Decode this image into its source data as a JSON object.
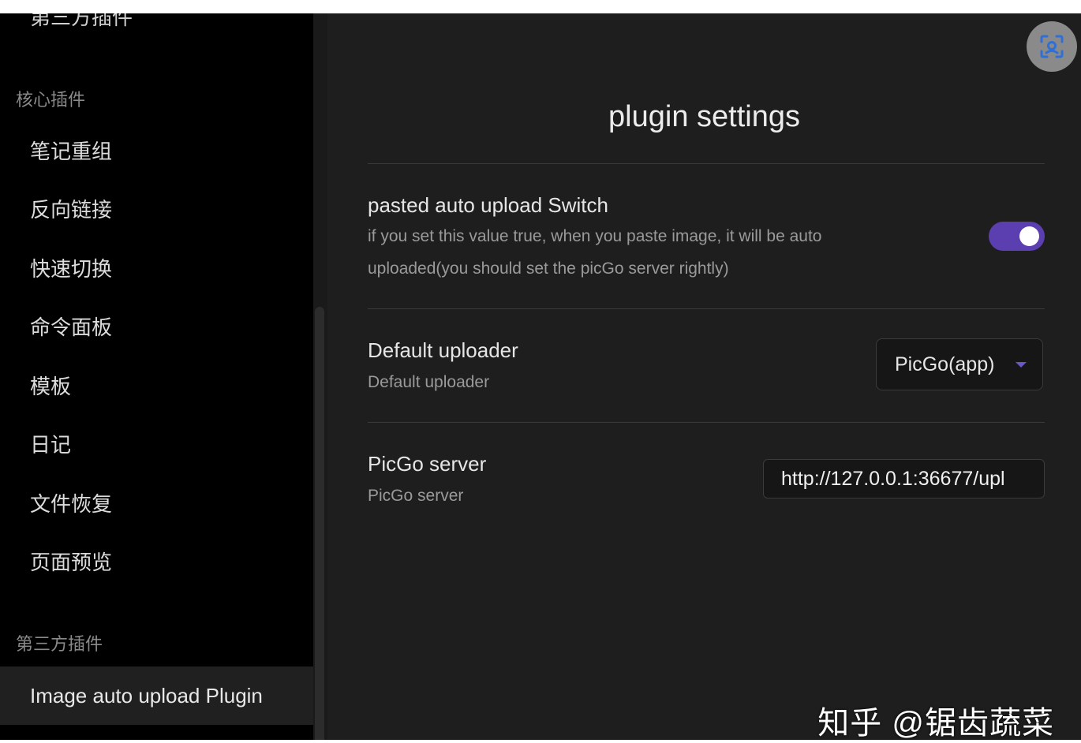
{
  "sidebar": {
    "top_partial_heading": "第三方插件",
    "core_heading": "核心插件",
    "core_items": [
      {
        "label": "笔记重组"
      },
      {
        "label": "反向链接"
      },
      {
        "label": "快速切换"
      },
      {
        "label": "命令面板"
      },
      {
        "label": "模板"
      },
      {
        "label": "日记"
      },
      {
        "label": "文件恢复"
      },
      {
        "label": "页面预览"
      }
    ],
    "third_party_heading": "第三方插件",
    "third_party_items": [
      {
        "label": "Image auto upload Plugin",
        "active": true
      }
    ]
  },
  "main": {
    "title": "plugin settings",
    "settings": [
      {
        "name": "pasted auto upload Switch",
        "description": "if you set this value true, when you paste image, it will be auto uploaded(you should set the picGo server rightly)",
        "control": "toggle",
        "value": true
      },
      {
        "name": "Default uploader",
        "description": "Default uploader",
        "control": "dropdown",
        "value": "PicGo(app)"
      },
      {
        "name": "PicGo server",
        "description": "PicGo server",
        "control": "text",
        "value": "http://127.0.0.1:36677/upl"
      }
    ]
  },
  "overlay": {
    "expand_icon": "expand-scan-icon",
    "watermark": "知乎 @锯齿蔬菜"
  },
  "colors": {
    "accent": "#5b3fb0",
    "background": "#1e1e1e",
    "sidebar": "#000000"
  }
}
